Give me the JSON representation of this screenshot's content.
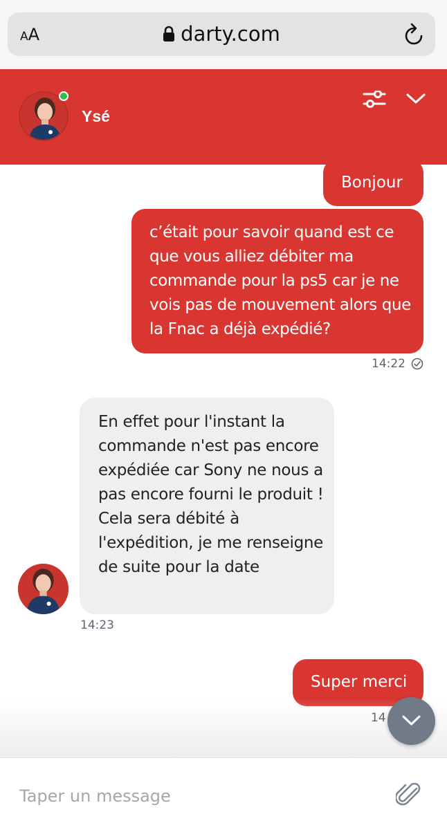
{
  "browser": {
    "text_size_small": "A",
    "text_size_large": "A",
    "domain": "darty.com"
  },
  "header": {
    "agent_name": "Ysé",
    "status": "online"
  },
  "messages": [
    {
      "from": "user",
      "text": "Bonjour"
    },
    {
      "from": "user",
      "text": "c’était pour savoir quand est ce que vous alliez débiter ma commande pour la ps5 car je ne vois pas de mouvement alors que la Fnac a déjà expédié?",
      "time": "14:22",
      "status": "read"
    },
    {
      "from": "agent",
      "text": "En effet pour l'instant la commande n'est pas encore expédiée car Sony ne nous a pas encore fourni le produit ! Cela sera débité à l'expédition, je me renseigne de suite pour la date",
      "time": "14:23"
    },
    {
      "from": "user",
      "text": "Super merci",
      "time": "14"
    }
  ],
  "composer": {
    "placeholder": "Taper un message"
  },
  "colors": {
    "brand_red": "#d93631",
    "agent_bubble": "#efefef",
    "online": "#2fbd4e",
    "scroll_button": "#717a87"
  },
  "icons": [
    "lock-icon",
    "reload-icon",
    "settings-sliders-icon",
    "chevron-down-icon",
    "read-check-icon",
    "scroll-down-icon",
    "paperclip-icon"
  ]
}
